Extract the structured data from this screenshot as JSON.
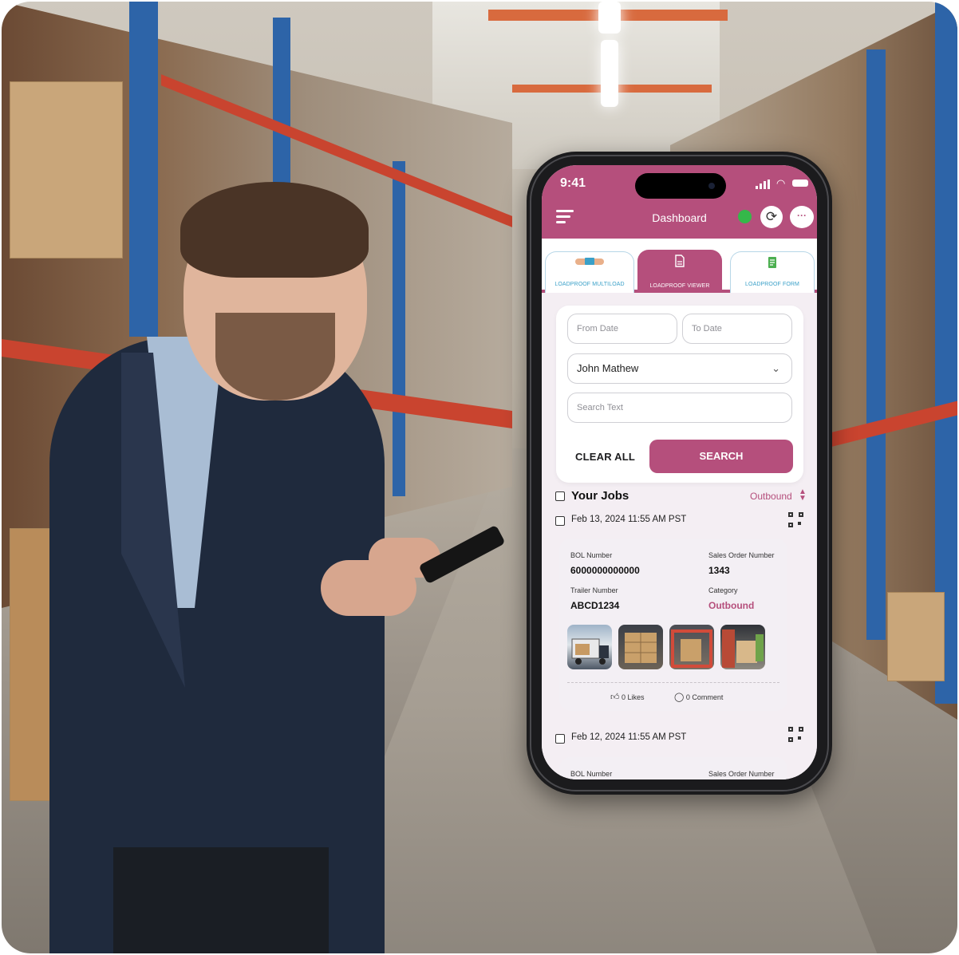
{
  "phone": {
    "status_time": "9:41",
    "header_title": "Dashboard",
    "online_color": "#35b84a",
    "accent_color": "#b54f7c"
  },
  "tabs": [
    {
      "label": "LOADPROOF MULTILOAD",
      "icon": "truck-icon",
      "active": false
    },
    {
      "label": "LOADPROOF VIEWER",
      "icon": "document-icon",
      "active": true
    },
    {
      "label": "LOADPROOF FORM",
      "icon": "form-icon",
      "active": false
    }
  ],
  "filters": {
    "from_date_placeholder": "From Date",
    "to_date_placeholder": "To Date",
    "user_selected": "John Mathew",
    "search_placeholder": "Search Text",
    "clear_label": "CLEAR ALL",
    "search_label": "SEARCH"
  },
  "jobs": {
    "title": "Your Jobs",
    "filter_value": "Outbound",
    "items": [
      {
        "datetime": "Feb 13, 2024 11:55 AM PST",
        "bol_label": "BOL Number",
        "bol_value": "6000000000000",
        "so_label": "Sales Order Number",
        "so_value": "1343",
        "trailer_label": "Trailer Number",
        "trailer_value": "ABCD1234",
        "category_label": "Category",
        "category_value": "Outbound",
        "likes": "0 Likes",
        "comments": "0 Comment"
      },
      {
        "datetime": "Feb 12, 2024 11:55 AM PST",
        "bol_label": "BOL Number",
        "so_label": "Sales Order Number"
      }
    ]
  }
}
